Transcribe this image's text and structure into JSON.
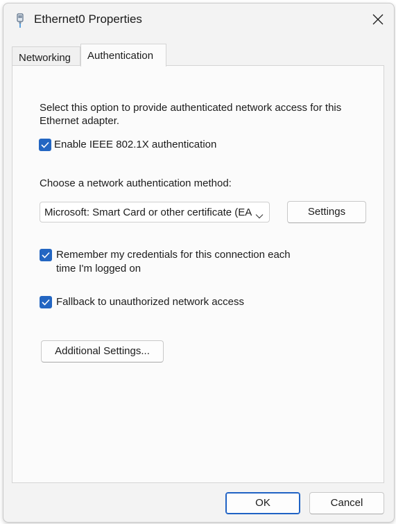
{
  "window": {
    "title": "Ethernet0 Properties"
  },
  "tabs": [
    {
      "label": "Networking",
      "active": false
    },
    {
      "label": "Authentication",
      "active": true
    }
  ],
  "auth": {
    "description": "Select this option to provide authenticated network access for this Ethernet adapter.",
    "enable_8021x": {
      "label": "Enable IEEE 802.1X authentication",
      "checked": true
    },
    "method_label": "Choose a network authentication method:",
    "method_value": "Microsoft: Smart Card or other certificate (EAP-TLS)",
    "settings_button": "Settings",
    "remember": {
      "label_line1": "Remember my credentials for this connection each",
      "label_line2": "time I'm logged on",
      "checked": true
    },
    "fallback": {
      "label": "Fallback to unauthorized network access",
      "checked": true
    },
    "additional_button": "Additional Settings..."
  },
  "footer": {
    "ok": "OK",
    "cancel": "Cancel"
  },
  "colors": {
    "accent": "#2366c2",
    "primary_border": "#1f62c4",
    "window_bg": "#f3f3f3"
  },
  "icons": {
    "title": "network-adapter-icon",
    "close": "close-icon",
    "dropdown": "chevron-down-icon",
    "check": "checkmark-icon"
  }
}
